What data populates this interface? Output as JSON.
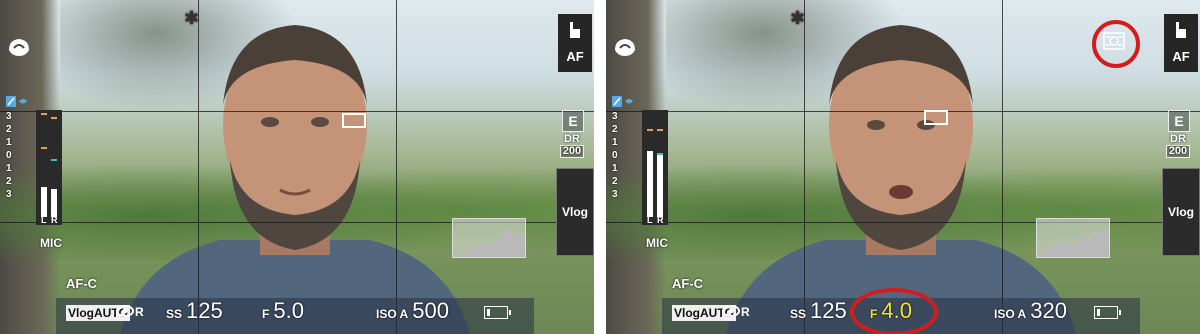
{
  "screens": [
    {
      "af_label": "AF",
      "film_sim": "Vlog",
      "e_label": "E",
      "dr_label": "DR",
      "dr_value": "200",
      "exposure_scale": [
        "3",
        "2",
        "1",
        "0",
        "1",
        "2",
        "3"
      ],
      "meter_channels": [
        "L",
        "R"
      ],
      "mic_label": "MIC",
      "af_mode": "AF-C",
      "vlog_auto": "VlogAUTO",
      "shutter_label": "SS",
      "shutter_value": "125",
      "aperture_label": "F",
      "aperture_value": "5.0",
      "iso_label": "ISO A",
      "iso_value": "500",
      "icons": [
        "bluetooth-icon",
        "face-detect-icon",
        "exposure-comp-icon",
        "eye-af-icon",
        "battery-icon",
        "touch-af-icon"
      ]
    },
    {
      "af_label": "AF",
      "film_sim": "Vlog",
      "e_label": "E",
      "dr_label": "DR",
      "dr_value": "200",
      "exposure_scale": [
        "3",
        "2",
        "1",
        "0",
        "1",
        "2",
        "3"
      ],
      "meter_channels": [
        "L",
        "R"
      ],
      "mic_label": "MIC",
      "af_mode": "AF-C",
      "vlog_auto": "VlogAUTO",
      "shutter_label": "SS",
      "shutter_value": "125",
      "aperture_label": "F",
      "aperture_value": "4.0",
      "iso_label": "ISO A",
      "iso_value": "320",
      "icons": [
        "bluetooth-icon",
        "face-detect-icon",
        "exposure-comp-icon",
        "eye-af-icon",
        "battery-icon",
        "touch-af-icon",
        "defocus-icon"
      ],
      "highlight_color": "#d41c1c",
      "aperture_color": "#f3e235"
    }
  ]
}
